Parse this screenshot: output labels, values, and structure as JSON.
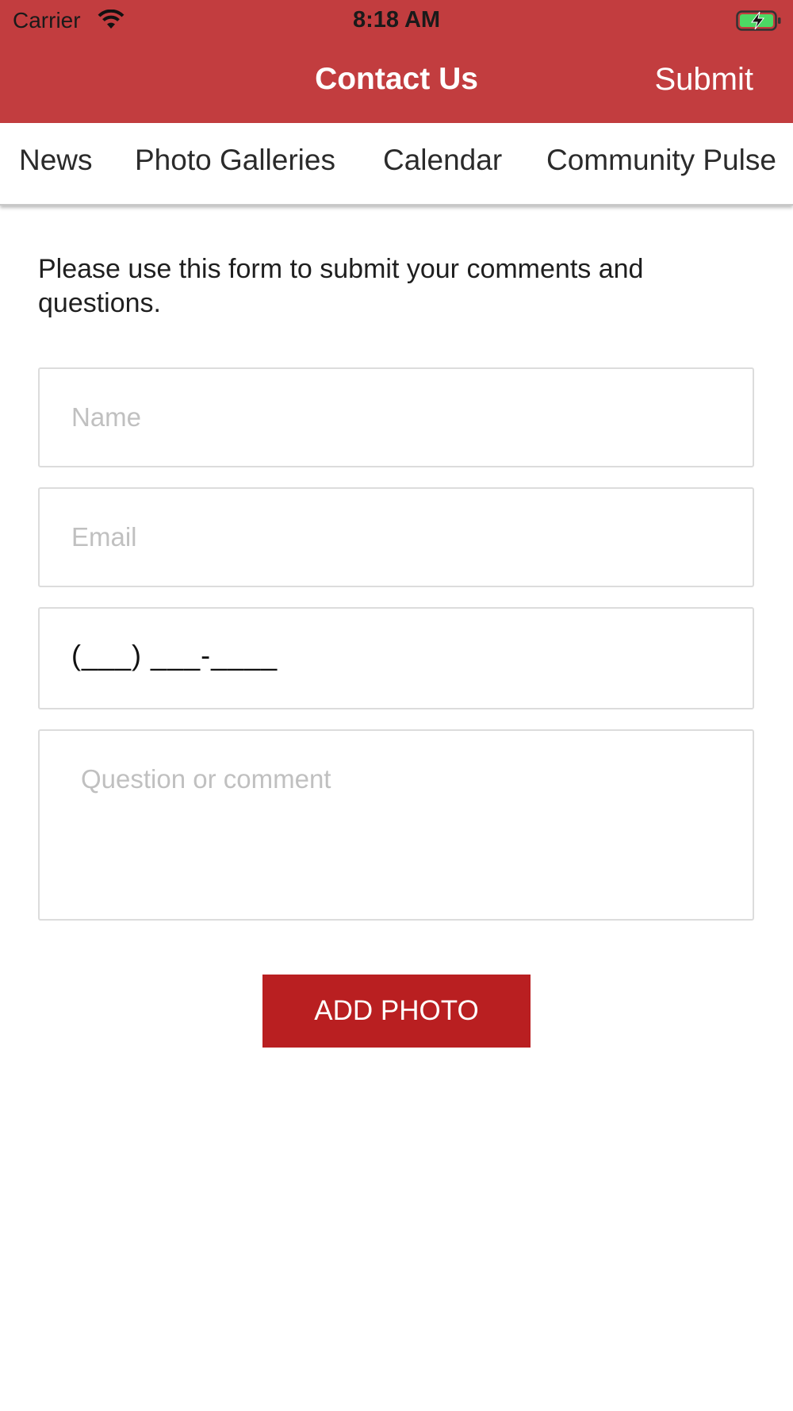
{
  "status_bar": {
    "carrier": "Carrier",
    "time": "8:18 AM",
    "wifi_icon": "wifi-icon",
    "battery_icon": "battery-charging-icon"
  },
  "nav": {
    "title": "Contact Us",
    "submit_label": "Submit",
    "bar_color": "#c23d3f"
  },
  "tabs": [
    {
      "label": "News"
    },
    {
      "label": "Photo Galleries"
    },
    {
      "label": "Calendar"
    },
    {
      "label": "Community Pulse"
    }
  ],
  "form": {
    "intro": "Please use this form to submit your comments and questions.",
    "name_placeholder": "Name",
    "email_placeholder": "Email",
    "phone_value": "(___) ___-____",
    "comment_placeholder": "Question or comment",
    "add_photo_label": "ADD PHOTO",
    "button_color": "#b91f21"
  }
}
